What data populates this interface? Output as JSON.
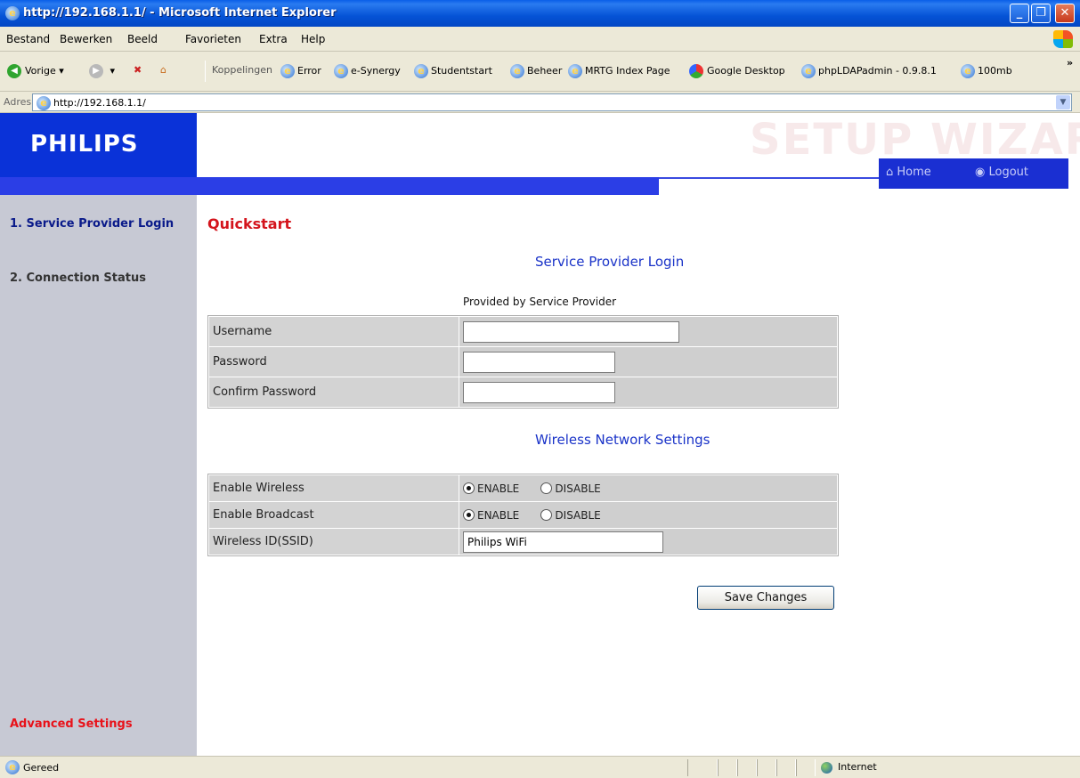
{
  "window": {
    "title": "http://192.168.1.1/ - Microsoft Internet Explorer",
    "controls": {
      "minimize": "_",
      "maximize": "❐",
      "close": "✕"
    }
  },
  "menubar": [
    "Bestand",
    "Bewerken",
    "Beeld",
    "Favorieten",
    "Extra",
    "Help"
  ],
  "toolbar": {
    "back_label": "Vorige",
    "links_label": "Koppelingen",
    "links": [
      "Error",
      "e-Synergy",
      "Studentstart",
      "Beheer",
      "MRTG Index Page",
      "Google Desktop",
      "phpLDAPadmin - 0.9.8.1",
      "100mb"
    ]
  },
  "address": {
    "label": "Adres",
    "url": "http://192.168.1.1/"
  },
  "page": {
    "logo": "PHILIPS",
    "wizard_title": "SETUP WIZARD",
    "nav": {
      "home": "Home",
      "logout": "Logout"
    },
    "sidebar": {
      "items": [
        "1. Service Provider Login",
        "2. Connection Status"
      ],
      "advanced": "Advanced Settings"
    },
    "heading": "Quickstart",
    "login_section": {
      "title": "Service Provider Login",
      "subtitle": "Provided by Service Provider",
      "fields": [
        {
          "label": "Username",
          "value": ""
        },
        {
          "label": "Password",
          "value": ""
        },
        {
          "label": "Confirm Password",
          "value": ""
        }
      ]
    },
    "wireless_section": {
      "title": "Wireless Network Settings",
      "enable_wireless": {
        "label": "Enable Wireless",
        "options": [
          "ENABLE",
          "DISABLE"
        ],
        "selected": "ENABLE"
      },
      "enable_broadcast": {
        "label": "Enable Broadcast",
        "options": [
          "ENABLE",
          "DISABLE"
        ],
        "selected": "ENABLE"
      },
      "ssid": {
        "label": "Wireless ID(SSID)",
        "value": "Philips WiFi"
      }
    },
    "save_button": "Save Changes"
  },
  "statusbar": {
    "status": "Gereed",
    "zone": "Internet"
  },
  "colors": {
    "philips_blue": "#0a32d8",
    "accent_red": "#d4141c",
    "section_blue": "#1a33c8",
    "sidebar_bg": "#c7c9d4"
  }
}
